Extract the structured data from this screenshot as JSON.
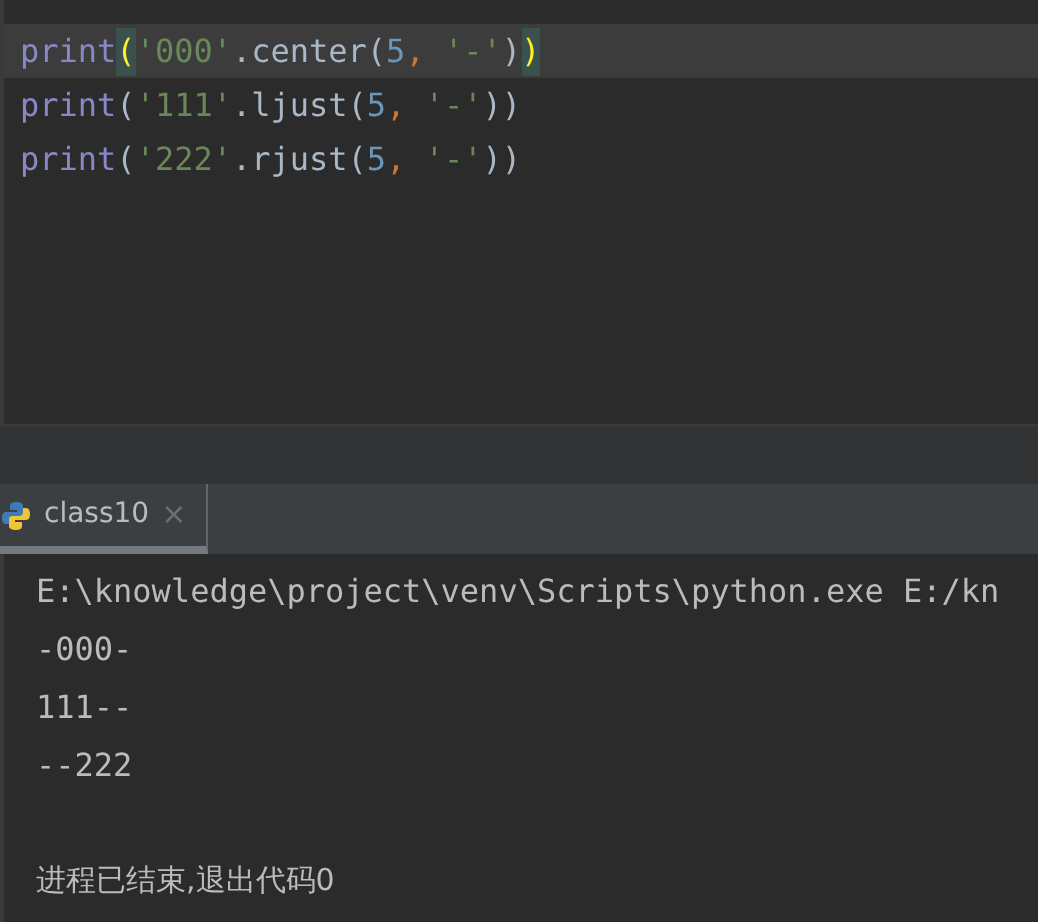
{
  "editor": {
    "lines": [
      {
        "current": true,
        "tokens": [
          {
            "text": "print",
            "kind": "func"
          },
          {
            "text": "(",
            "kind": "brace-match"
          },
          {
            "text": "'000'",
            "kind": "string"
          },
          {
            "text": ".center(",
            "kind": "plain"
          },
          {
            "text": "5",
            "kind": "number"
          },
          {
            "text": ", ",
            "kind": "comma"
          },
          {
            "text": "'-'",
            "kind": "string"
          },
          {
            "text": ")",
            "kind": "plain"
          },
          {
            "text": ")",
            "kind": "brace-match"
          }
        ]
      },
      {
        "current": false,
        "tokens": [
          {
            "text": "print",
            "kind": "func"
          },
          {
            "text": "(",
            "kind": "plain"
          },
          {
            "text": "'111'",
            "kind": "string"
          },
          {
            "text": ".ljust(",
            "kind": "plain"
          },
          {
            "text": "5",
            "kind": "number"
          },
          {
            "text": ", ",
            "kind": "comma"
          },
          {
            "text": "'-'",
            "kind": "string"
          },
          {
            "text": "))",
            "kind": "plain"
          }
        ]
      },
      {
        "current": false,
        "tokens": [
          {
            "text": "print",
            "kind": "func"
          },
          {
            "text": "(",
            "kind": "plain"
          },
          {
            "text": "'222'",
            "kind": "string"
          },
          {
            "text": ".rjust(",
            "kind": "plain"
          },
          {
            "text": "5",
            "kind": "number"
          },
          {
            "text": ", ",
            "kind": "comma"
          },
          {
            "text": "'-'",
            "kind": "string"
          },
          {
            "text": "))",
            "kind": "plain"
          }
        ]
      }
    ]
  },
  "run_tabs": [
    {
      "label": "class10",
      "close": "×",
      "selected": true
    }
  ],
  "console": {
    "lines": [
      {
        "text": "E:\\knowledge\\project\\venv\\Scripts\\python.exe E:/kn",
        "kind": "command"
      },
      {
        "text": "-000-",
        "kind": "output"
      },
      {
        "text": "111--",
        "kind": "output"
      },
      {
        "text": "--222",
        "kind": "output"
      },
      {
        "text": "进程已结束,退出代码0",
        "kind": "exit"
      }
    ]
  }
}
